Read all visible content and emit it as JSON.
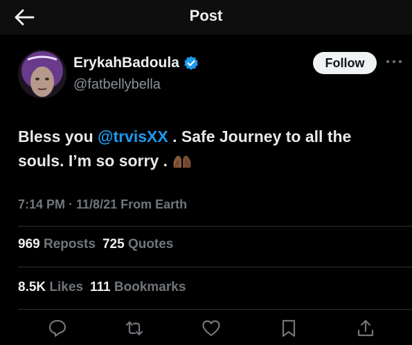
{
  "header": {
    "title": "Post"
  },
  "author": {
    "display_name": "ErykahBadoula",
    "handle": "@fatbellybella",
    "follow_label": "Follow"
  },
  "tweet": {
    "text_part1": "Bless you ",
    "mention": "@trvisXX",
    "text_part2": " . Safe Journey to all the souls. I’m so sorry . ",
    "emoji": "folded-hands-emoji",
    "meta": "7:14 PM · 11/8/21 From Earth"
  },
  "stats": {
    "reposts_count": "969",
    "reposts_label": "Reposts",
    "quotes_count": "725",
    "quotes_label": "Quotes",
    "likes_count": "8.5K",
    "likes_label": "Likes",
    "bookmarks_count": "111",
    "bookmarks_label": "Bookmarks"
  },
  "icons": {
    "back": "arrow-left-icon",
    "verified": "verified-badge-icon",
    "more": "more-icon",
    "reply": "reply-icon",
    "repost": "repost-icon",
    "like": "heart-icon",
    "bookmark": "bookmark-icon",
    "share": "share-icon"
  },
  "colors": {
    "accent": "#1d9bf0",
    "background": "#000000",
    "muted": "#71767b"
  }
}
